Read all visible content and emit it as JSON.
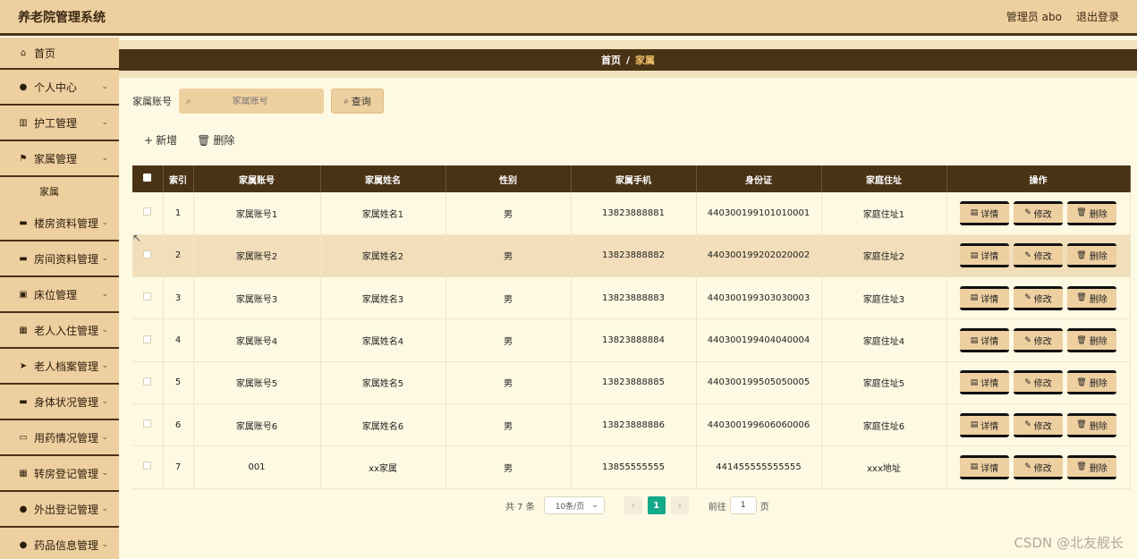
{
  "header": {
    "title": "养老院管理系统",
    "user": "管理员 abo",
    "logout": "退出登录"
  },
  "sidebar": {
    "items": [
      {
        "label": "首页",
        "icon": "home-icon",
        "glyph": "⌂"
      },
      {
        "label": "个人中心",
        "icon": "user-icon",
        "glyph": "●"
      },
      {
        "label": "护工管理",
        "icon": "chart-icon",
        "glyph": "▥"
      },
      {
        "label": "家属管理",
        "icon": "flag-icon",
        "glyph": "⚑"
      },
      {
        "label": "楼房资料管理",
        "icon": "message-icon",
        "glyph": "▬"
      },
      {
        "label": "房间资料管理",
        "icon": "card-icon",
        "glyph": "▬"
      },
      {
        "label": "床位管理",
        "icon": "calendar-icon",
        "glyph": "▣"
      },
      {
        "label": "老人入住管理",
        "icon": "grid-icon",
        "glyph": "▦"
      },
      {
        "label": "老人档案管理",
        "icon": "send-icon",
        "glyph": "➤"
      },
      {
        "label": "身体状况管理",
        "icon": "note-icon",
        "glyph": "▬"
      },
      {
        "label": "用药情况管理",
        "icon": "bag-icon",
        "glyph": "▭"
      },
      {
        "label": "转房登记管理",
        "icon": "grid-icon",
        "glyph": "▦"
      },
      {
        "label": "外出登记管理",
        "icon": "person-icon",
        "glyph": "●"
      },
      {
        "label": "药品信息管理",
        "icon": "pin-icon",
        "glyph": "●"
      }
    ],
    "sub_item": "家属"
  },
  "breadcrumb": {
    "home": "首页",
    "sep": "/",
    "current": "家属"
  },
  "search": {
    "label": "家属账号",
    "placeholder": "家属账号",
    "button": "查询"
  },
  "actions": {
    "add": "新增",
    "delete": "删除"
  },
  "table": {
    "headers": [
      "索引",
      "家属账号",
      "家属姓名",
      "性别",
      "家属手机",
      "身份证",
      "家庭住址",
      "操作"
    ],
    "rows": [
      {
        "index": "1",
        "account": "家属账号1",
        "name": "家属姓名1",
        "gender": "男",
        "phone": "13823888881",
        "id_card": "440300199101010001",
        "address": "家庭住址1"
      },
      {
        "index": "2",
        "account": "家属账号2",
        "name": "家属姓名2",
        "gender": "男",
        "phone": "13823888882",
        "id_card": "440300199202020002",
        "address": "家庭住址2"
      },
      {
        "index": "3",
        "account": "家属账号3",
        "name": "家属姓名3",
        "gender": "男",
        "phone": "13823888883",
        "id_card": "440300199303030003",
        "address": "家庭住址3"
      },
      {
        "index": "4",
        "account": "家属账号4",
        "name": "家属姓名4",
        "gender": "男",
        "phone": "13823888884",
        "id_card": "440300199404040004",
        "address": "家庭住址4"
      },
      {
        "index": "5",
        "account": "家属账号5",
        "name": "家属姓名5",
        "gender": "男",
        "phone": "13823888885",
        "id_card": "440300199505050005",
        "address": "家庭住址5"
      },
      {
        "index": "6",
        "account": "家属账号6",
        "name": "家属姓名6",
        "gender": "男",
        "phone": "13823888886",
        "id_card": "440300199606060006",
        "address": "家庭住址6"
      },
      {
        "index": "7",
        "account": "001",
        "name": "xx家属",
        "gender": "男",
        "phone": "13855555555",
        "id_card": "441455555555555",
        "address": "xxx地址"
      }
    ],
    "op_labels": {
      "detail": "详情",
      "edit": "修改",
      "delete": "删除"
    }
  },
  "pagination": {
    "total": "共 7 条",
    "page_size": "10条/页",
    "current_page": "1",
    "goto_label": "前往",
    "goto_value": "1",
    "goto_unit": "页"
  },
  "watermark": "CSDN @北友舰长",
  "colors": {
    "accent": "#4a3215",
    "panel": "#eecfa0",
    "page_bg": "#fdf9e2",
    "pager_active": "#14a98b"
  }
}
